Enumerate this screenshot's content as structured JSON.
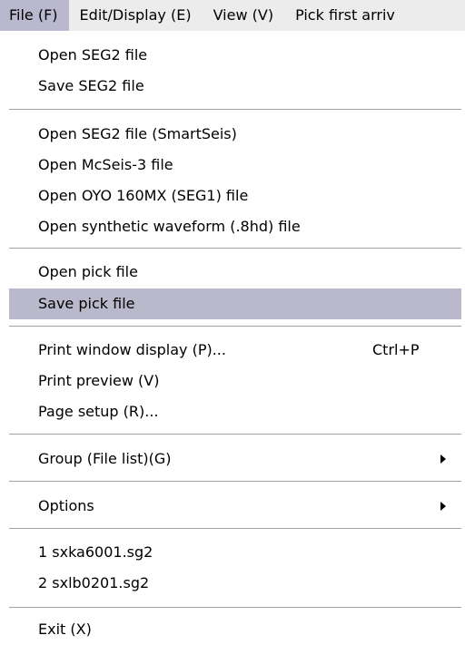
{
  "menubar": {
    "items": [
      "File (F)",
      "Edit/Display (E)",
      "View (V)",
      "Pick first arriv"
    ]
  },
  "file_menu": {
    "open_seg2": "Open SEG2 file",
    "save_seg2": "Save SEG2 file",
    "open_seg2_smartseis": "Open SEG2 file (SmartSeis)",
    "open_mcseis3": "Open McSeis-3 file",
    "open_oyo160mx": "Open OYO 160MX (SEG1) file",
    "open_synthetic": "Open synthetic waveform (.8hd) file",
    "open_pick": "Open pick file",
    "save_pick": "Save pick file",
    "print_window": "Print window display (P)...",
    "print_window_shortcut": "Ctrl+P",
    "print_preview": "Print preview (V)",
    "page_setup": "Page setup (R)...",
    "group": "Group (File list)(G)",
    "options": "Options",
    "recent_1": "1 sxka6001.sg2",
    "recent_2": "2 sxlb0201.sg2",
    "exit": "Exit (X)"
  },
  "colors": {
    "selected_bg": "#bab9cc",
    "menubar_bg": "#ececec",
    "separator": "#a0a0a0"
  }
}
